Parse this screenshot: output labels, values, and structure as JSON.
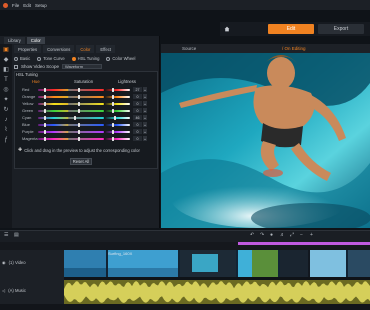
{
  "menubar": {
    "items": [
      "File",
      "Edit",
      "Setup"
    ]
  },
  "top_tabs": {
    "edit": "Edit",
    "export": "Export"
  },
  "panel_tabs": [
    "Library",
    "Color"
  ],
  "sub_tabs": [
    "Properties",
    "Conversions",
    "Color",
    "Effect"
  ],
  "radio_options": [
    {
      "label": "Basic",
      "on": false
    },
    {
      "label": "Tone Curve",
      "on": false
    },
    {
      "label": "HSL Tuning",
      "on": true
    },
    {
      "label": "Color Wheel",
      "on": false
    }
  ],
  "scope": {
    "checkbox_label": "Show Video Scope",
    "select_value": "Waveform"
  },
  "hsl": {
    "title": "HSL Tuning",
    "headers": {
      "hue": "Hue",
      "saturation": "Saturation",
      "lightness": "Lightness"
    },
    "rows": [
      {
        "label": "Red",
        "value": "27"
      },
      {
        "label": "Orange",
        "value": "0"
      },
      {
        "label": "Yellow",
        "value": "0"
      },
      {
        "label": "Green",
        "value": "0"
      },
      {
        "label": "Cyan",
        "value": "46"
      },
      {
        "label": "Blue",
        "value": "0"
      },
      {
        "label": "Purple",
        "value": "0"
      },
      {
        "label": "Magenta",
        "value": "0"
      }
    ],
    "hint": "Click and drag in the preview to adjust the corresponding color",
    "reset_label": "Reset All"
  },
  "preview": {
    "source_label": "Source",
    "editing_label": "/ On Editing"
  },
  "timeline": {
    "video_track_label": "(1) Video",
    "music_track_label": "(A) Music",
    "clip_label": "Surfing_160X"
  },
  "colors": {
    "accent": "#f08221",
    "playhead": "#c05ae0"
  }
}
